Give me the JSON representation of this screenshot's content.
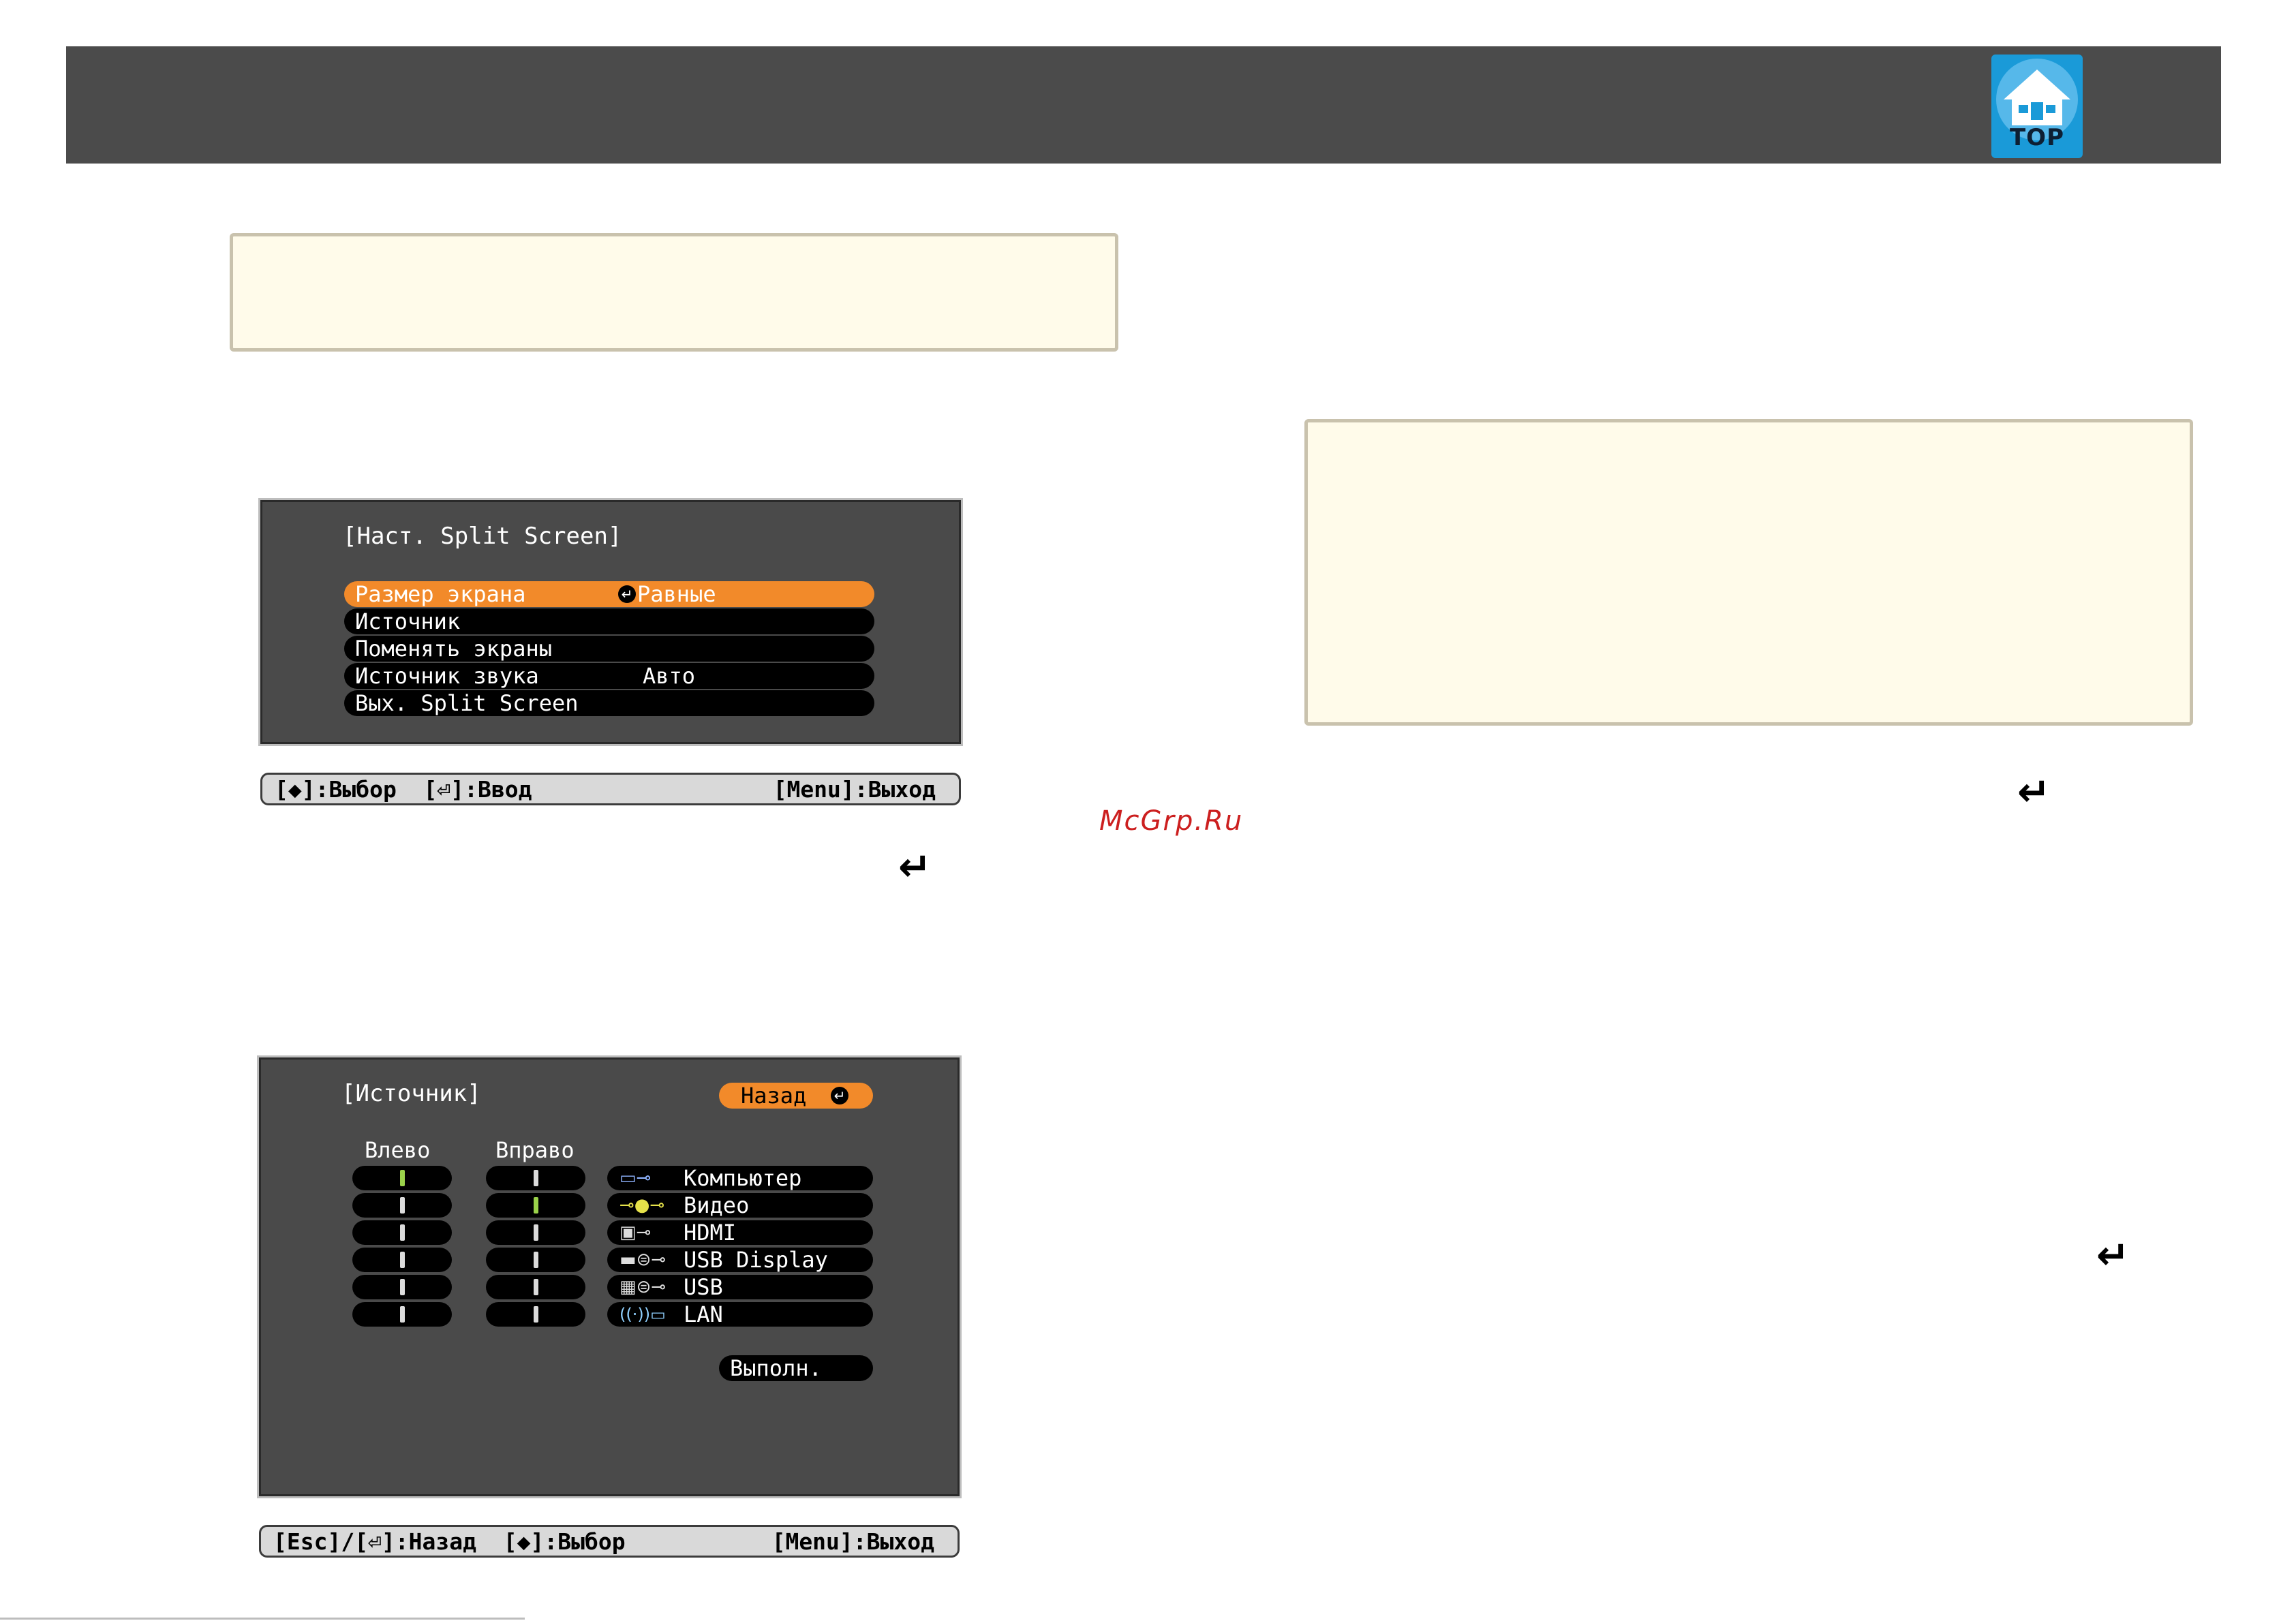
{
  "header": {
    "logo_label": "TOP"
  },
  "watermark": "McGrp.Ru",
  "split_menu": {
    "title": "[Наст. Split Screen]",
    "items": [
      {
        "label": "Размер экрана",
        "value": "Равные",
        "selected": true
      },
      {
        "label": "Источник",
        "value": ""
      },
      {
        "label": "Поменять экраны",
        "value": ""
      },
      {
        "label": "Источник звука",
        "value": "Авто"
      },
      {
        "label": "Вых. Split Screen",
        "value": ""
      }
    ],
    "help_left": "[◆]:Выбор  [⏎]:Ввод",
    "help_right": "[Menu]:Выход"
  },
  "source_menu": {
    "title": "[Источник]",
    "back_button": "Назад",
    "col_left": "Влево",
    "col_right": "Вправо",
    "sources": [
      {
        "label": "Компьютер",
        "icon": "computer-port-icon",
        "left_on": true,
        "right_on": false
      },
      {
        "label": "Видео",
        "icon": "video-port-icon",
        "left_on": false,
        "right_on": true
      },
      {
        "label": "HDMI",
        "icon": "hdmi-port-icon",
        "left_on": false,
        "right_on": false
      },
      {
        "label": "USB Display",
        "icon": "usb-display-port-icon",
        "left_on": false,
        "right_on": false
      },
      {
        "label": "USB",
        "icon": "usb-port-icon",
        "left_on": false,
        "right_on": false
      },
      {
        "label": "LAN",
        "icon": "lan-wireless-icon",
        "left_on": false,
        "right_on": false
      }
    ],
    "execute_button": "Выполн.",
    "help_left": "[Esc]/[⏎]:Назад  [◆]:Выбор",
    "help_right": "[Menu]:Выход"
  },
  "colors": {
    "header": "#4b4b4b",
    "note_bg": "#fffbea",
    "osd_bg": "#4a4a4a",
    "highlight": "#f28a2a",
    "watermark": "#cc1f1f"
  }
}
